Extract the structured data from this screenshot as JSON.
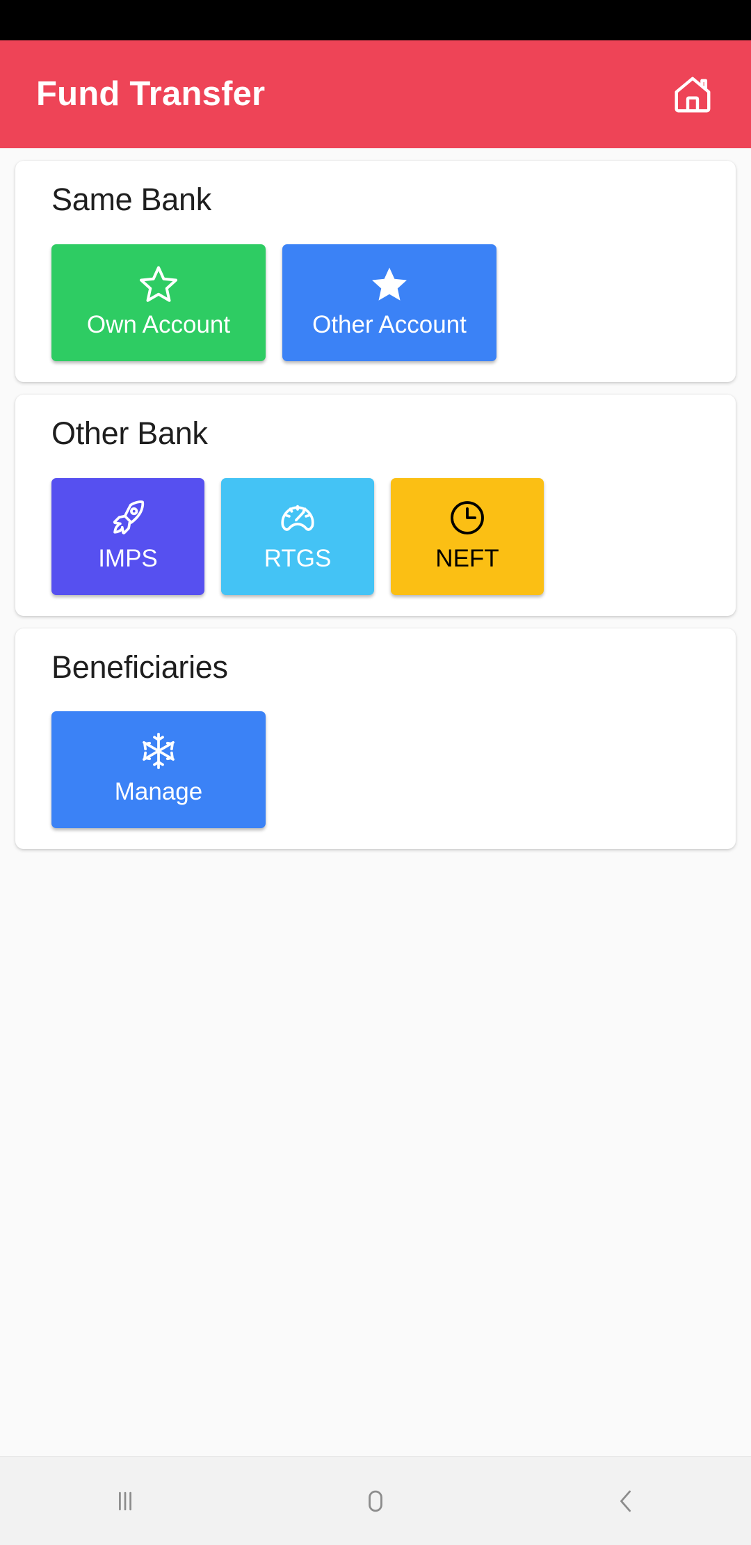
{
  "app_bar": {
    "title": "Fund Transfer",
    "home_icon": "home-icon"
  },
  "status_bar": {
    "background": "#000000"
  },
  "theme": {
    "app_bar_color": "#EE4457",
    "page_background": "#FAFAFA",
    "card_background": "#FFFFFF",
    "title_color": "#1E1E1E"
  },
  "sections": [
    {
      "title": "Same Bank",
      "tiles": [
        {
          "label": "Own Account",
          "icon": "star-outline-icon",
          "color": "#2ECC63",
          "text_color": "#FFFFFF"
        },
        {
          "label": "Other Account",
          "icon": "star-filled-icon",
          "color": "#3B82F6",
          "text_color": "#FFFFFF"
        }
      ]
    },
    {
      "title": "Other Bank",
      "tiles": [
        {
          "label": "IMPS",
          "icon": "rocket-icon",
          "color": "#5650F0",
          "text_color": "#FFFFFF"
        },
        {
          "label": "RTGS",
          "icon": "speedometer-icon",
          "color": "#44C3F5",
          "text_color": "#FFFFFF"
        },
        {
          "label": "NEFT",
          "icon": "clock-icon",
          "color": "#FBBF14",
          "text_color": "#000000"
        }
      ]
    },
    {
      "title": "Beneficiaries",
      "tiles": [
        {
          "label": "Manage",
          "icon": "snowflake-icon",
          "color": "#3B82F6",
          "text_color": "#FFFFFF"
        }
      ]
    }
  ],
  "nav_bar": {
    "buttons": [
      {
        "name": "recents-icon",
        "label": "Recents"
      },
      {
        "name": "home-square-icon",
        "label": "Home"
      },
      {
        "name": "back-chevron-icon",
        "label": "Back"
      }
    ]
  }
}
